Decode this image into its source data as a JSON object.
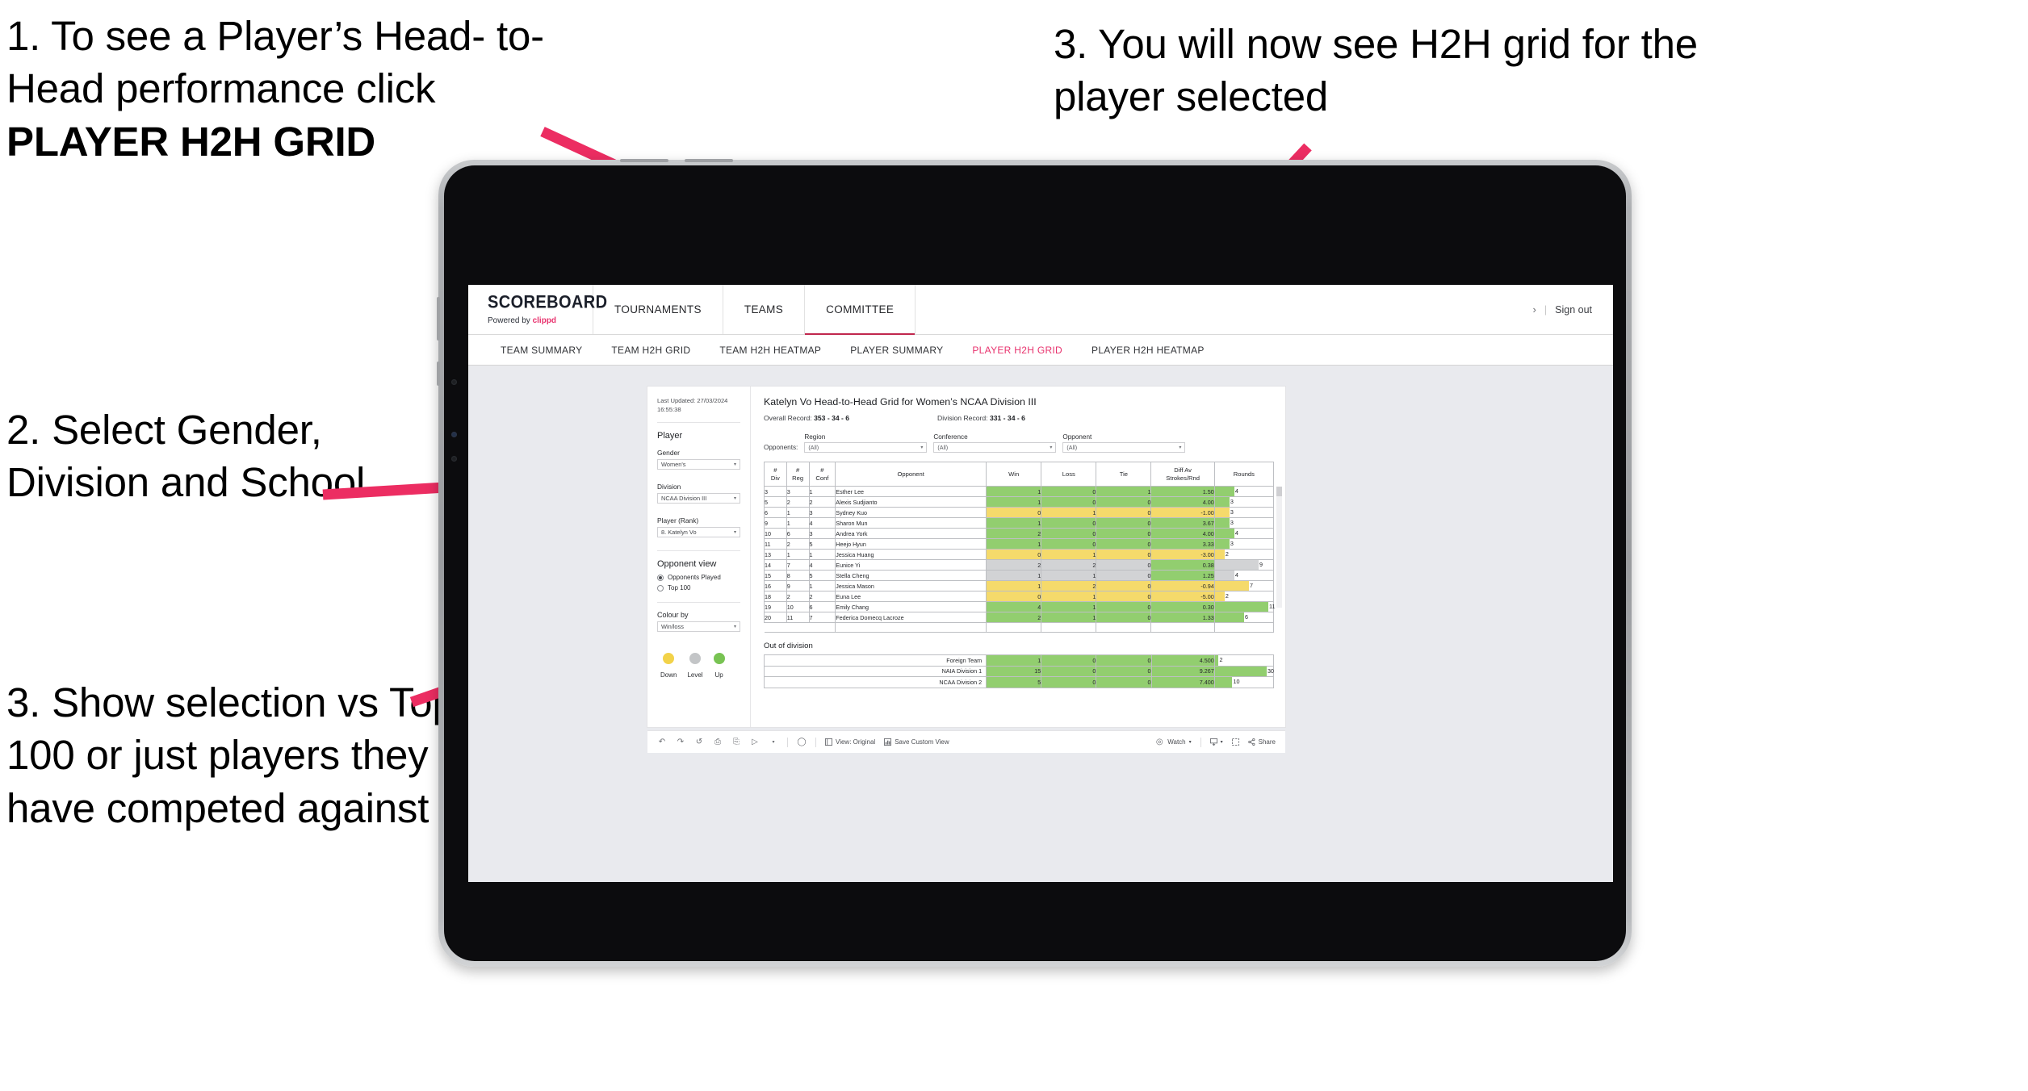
{
  "annotations": [
    {
      "id": "a1",
      "line1": "1. To see a Player’s Head-",
      "line2": "to-Head performance click",
      "line3": "PLAYER H2H GRID"
    },
    {
      "id": "a2",
      "text": "2. Select Gender, Division and School"
    },
    {
      "id": "a3",
      "text": "3. Show selection vs Top 100 or just players they have competed against"
    },
    {
      "id": "a4",
      "text": "3. You will now see H2H grid for the player selected"
    }
  ],
  "accent_color": "#ec2d62",
  "app": {
    "logo": {
      "word": "SCOREBOARD",
      "powered_prefix": "Powered by ",
      "brand": "clippd"
    },
    "header_tabs": [
      {
        "label": "TOURNAMENTS",
        "active": false
      },
      {
        "label": "TEAMS",
        "active": false
      },
      {
        "label": "COMMITTEE",
        "active": true
      }
    ],
    "header_right": {
      "chevron": "›",
      "separator": "|",
      "sign_out": "Sign out"
    },
    "subnav": [
      {
        "label": "TEAM SUMMARY",
        "active": false
      },
      {
        "label": "TEAM H2H GRID",
        "active": false
      },
      {
        "label": "TEAM H2H HEATMAP",
        "active": false
      },
      {
        "label": "PLAYER SUMMARY",
        "active": false
      },
      {
        "label": "PLAYER H2H GRID",
        "active": true
      },
      {
        "label": "PLAYER H2H HEATMAP",
        "active": false
      }
    ]
  },
  "panel": {
    "last_updated": "Last Updated: 27/03/2024 16:55:38",
    "section_player": "Player",
    "gender": {
      "label": "Gender",
      "value": "Women's"
    },
    "division": {
      "label": "Division",
      "value": "NCAA Division III"
    },
    "player_rank": {
      "label": "Player (Rank)",
      "value": "8. Katelyn Vo"
    },
    "opponent_view": {
      "title": "Opponent view",
      "options": [
        {
          "label": "Opponents Played",
          "selected": true
        },
        {
          "label": "Top 100",
          "selected": false
        }
      ]
    },
    "colour_by": {
      "label": "Colour by",
      "value": "Win/loss"
    },
    "legend": [
      {
        "label": "Down",
        "color": "#f2d249"
      },
      {
        "label": "Level",
        "color": "#c3c5c7"
      },
      {
        "label": "Up",
        "color": "#78c353"
      }
    ]
  },
  "viz": {
    "title": "Katelyn Vo Head-to-Head Grid for Women’s NCAA Division III",
    "overall_record_label": "Overall Record: ",
    "overall_record_value": "353 -  34 - 6",
    "division_record_label": "Division Record: ",
    "division_record_value": "331 -  34 - 6",
    "opponents_label": "Opponents:",
    "filters": [
      {
        "label": "Region",
        "value": "(All)"
      },
      {
        "label": "Conference",
        "value": "(All)"
      },
      {
        "label": "Opponent",
        "value": "(All)"
      }
    ],
    "columns": [
      "# Div",
      "# Reg",
      "# Conf",
      "Opponent",
      "Win",
      "Loss",
      "Tie",
      "Diff Av Strokes/Rnd",
      "Rounds"
    ],
    "out_of_division_title": "Out of division"
  },
  "chart_data": {
    "type": "table",
    "title": "Katelyn Vo Head-to-Head Grid for Women’s NCAA Division III",
    "columns": [
      "# Div",
      "# Reg",
      "# Conf",
      "Opponent",
      "Win",
      "Loss",
      "Tie",
      "Diff Av Strokes/Rnd",
      "Rounds"
    ],
    "color_scale": {
      "up": "#92ce6f",
      "level": "#d2d3d5",
      "down": "#f5da6b",
      "rounds_max": 12
    },
    "rows": [
      {
        "div": "3",
        "reg": "3",
        "conf": "1",
        "opponent": "Esther Lee",
        "win": "1",
        "loss": "0",
        "tie": "1",
        "diff": "1.50",
        "rounds": "4",
        "state": "up"
      },
      {
        "div": "5",
        "reg": "2",
        "conf": "2",
        "opponent": "Alexis Sudjianto",
        "win": "1",
        "loss": "0",
        "tie": "0",
        "diff": "4.00",
        "rounds": "3",
        "state": "up"
      },
      {
        "div": "6",
        "reg": "1",
        "conf": "3",
        "opponent": "Sydney Kuo",
        "win": "0",
        "loss": "1",
        "tie": "0",
        "diff": "-1.00",
        "rounds": "3",
        "state": "down"
      },
      {
        "div": "9",
        "reg": "1",
        "conf": "4",
        "opponent": "Sharon Mun",
        "win": "1",
        "loss": "0",
        "tie": "0",
        "diff": "3.67",
        "rounds": "3",
        "state": "up"
      },
      {
        "div": "10",
        "reg": "6",
        "conf": "3",
        "opponent": "Andrea York",
        "win": "2",
        "loss": "0",
        "tie": "0",
        "diff": "4.00",
        "rounds": "4",
        "state": "up"
      },
      {
        "div": "11",
        "reg": "2",
        "conf": "5",
        "opponent": "Heejo Hyun",
        "win": "1",
        "loss": "0",
        "tie": "0",
        "diff": "3.33",
        "rounds": "3",
        "state": "up"
      },
      {
        "div": "13",
        "reg": "1",
        "conf": "1",
        "opponent": "Jessica Huang",
        "win": "0",
        "loss": "1",
        "tie": "0",
        "diff": "-3.00",
        "rounds": "2",
        "state": "down"
      },
      {
        "div": "14",
        "reg": "7",
        "conf": "4",
        "opponent": "Eunice Yi",
        "win": "2",
        "loss": "2",
        "tie": "0",
        "diff": "0.38",
        "rounds": "9",
        "state": "level",
        "diff_state": "up"
      },
      {
        "div": "15",
        "reg": "8",
        "conf": "5",
        "opponent": "Stella Cheng",
        "win": "1",
        "loss": "1",
        "tie": "0",
        "diff": "1.25",
        "rounds": "4",
        "state": "level",
        "diff_state": "up"
      },
      {
        "div": "16",
        "reg": "9",
        "conf": "1",
        "opponent": "Jessica Mason",
        "win": "1",
        "loss": "2",
        "tie": "0",
        "diff": "-0.94",
        "rounds": "7",
        "state": "down"
      },
      {
        "div": "18",
        "reg": "2",
        "conf": "2",
        "opponent": "Euna Lee",
        "win": "0",
        "loss": "1",
        "tie": "0",
        "diff": "-5.00",
        "rounds": "2",
        "state": "down"
      },
      {
        "div": "19",
        "reg": "10",
        "conf": "6",
        "opponent": "Emily Chang",
        "win": "4",
        "loss": "1",
        "tie": "0",
        "diff": "0.30",
        "rounds": "11",
        "state": "up"
      },
      {
        "div": "20",
        "reg": "11",
        "conf": "7",
        "opponent": "Federica Domecq Lacroze",
        "win": "2",
        "loss": "1",
        "tie": "0",
        "diff": "1.33",
        "rounds": "6",
        "state": "up"
      }
    ],
    "out_of_division": [
      {
        "name": "Foreign Team",
        "win": "1",
        "loss": "0",
        "tie": "0",
        "diff": "4.500",
        "rounds": "2",
        "state": "up"
      },
      {
        "name": "NAIA Division 1",
        "win": "15",
        "loss": "0",
        "tie": "0",
        "diff": "9.267",
        "rounds": "30",
        "state": "up"
      },
      {
        "name": "NCAA Division 2",
        "win": "5",
        "loss": "0",
        "tie": "0",
        "diff": "7.400",
        "rounds": "10",
        "state": "up"
      }
    ],
    "out_of_division_rounds_max": 34
  },
  "toolbar": {
    "view_label": "View: Original",
    "save_label": "Save Custom View",
    "watch_label": "Watch",
    "share_label": "Share",
    "caret": "▾"
  }
}
